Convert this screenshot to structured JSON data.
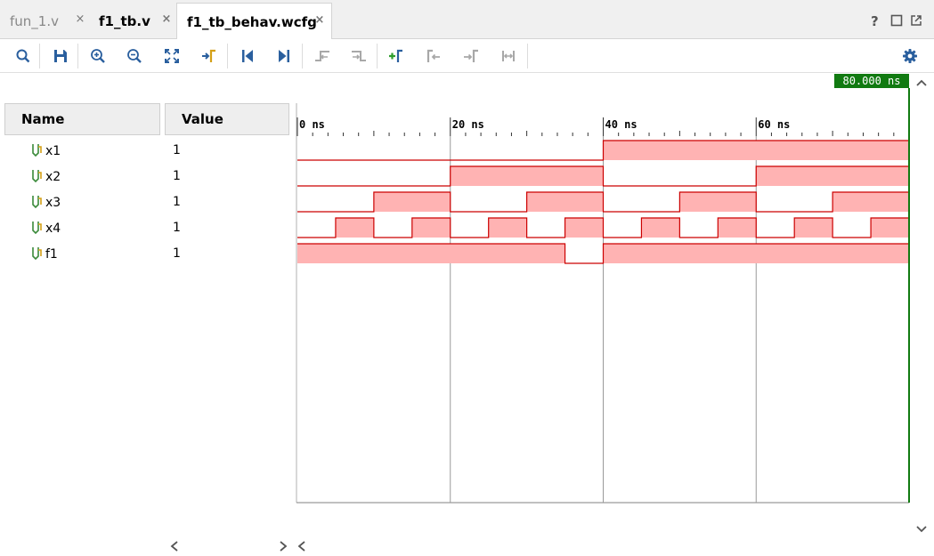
{
  "tabs": [
    {
      "label": "fun_1.v",
      "active": false
    },
    {
      "label": "f1_tb.v",
      "active": false
    },
    {
      "label": "f1_tb_behav.wcfg",
      "active": true
    }
  ],
  "tab_close_glyph": "×",
  "window_controls": {
    "help": "?"
  },
  "toolbar_icons": [
    "search-icon",
    "save-icon",
    "zoom-in-icon",
    "zoom-out-icon",
    "zoom-fit-icon",
    "go-to-cursor-icon",
    "go-to-time-zero-icon",
    "go-to-last-time-icon",
    "previous-transition-icon",
    "next-transition-icon",
    "add-marker-icon",
    "previous-marker-icon",
    "next-marker-icon",
    "swap-cursors-icon"
  ],
  "columns": {
    "name": "Name",
    "value": "Value"
  },
  "cursor": {
    "label": "80.000 ns",
    "time": 80
  },
  "timeline": {
    "unit": "ns",
    "ticks": [
      {
        "t": 0,
        "label": "0 ns"
      },
      {
        "t": 20,
        "label": "20 ns"
      },
      {
        "t": 40,
        "label": "40 ns"
      },
      {
        "t": 60,
        "label": "60 ns"
      }
    ],
    "end": 80
  },
  "signals": [
    {
      "name": "x1",
      "value": "1",
      "transitions": [
        [
          0,
          0
        ],
        [
          40,
          1
        ]
      ]
    },
    {
      "name": "x2",
      "value": "1",
      "transitions": [
        [
          0,
          0
        ],
        [
          20,
          1
        ],
        [
          40,
          0
        ],
        [
          60,
          1
        ]
      ]
    },
    {
      "name": "x3",
      "value": "1",
      "transitions": [
        [
          0,
          0
        ],
        [
          10,
          1
        ],
        [
          20,
          0
        ],
        [
          30,
          1
        ],
        [
          40,
          0
        ],
        [
          50,
          1
        ],
        [
          60,
          0
        ],
        [
          70,
          1
        ]
      ]
    },
    {
      "name": "x4",
      "value": "1",
      "transitions": [
        [
          0,
          0
        ],
        [
          5,
          1
        ],
        [
          10,
          0
        ],
        [
          15,
          1
        ],
        [
          20,
          0
        ],
        [
          25,
          1
        ],
        [
          30,
          0
        ],
        [
          35,
          1
        ],
        [
          40,
          0
        ],
        [
          45,
          1
        ],
        [
          50,
          0
        ],
        [
          55,
          1
        ],
        [
          60,
          0
        ],
        [
          65,
          1
        ],
        [
          70,
          0
        ],
        [
          75,
          1
        ]
      ]
    },
    {
      "name": "f1",
      "value": "1",
      "transitions": [
        [
          0,
          1
        ],
        [
          35,
          0
        ],
        [
          40,
          1
        ]
      ]
    }
  ],
  "colors": {
    "high_fill": "#ffb3b3",
    "wave_line": "#cc0000",
    "cursor": "#117a11",
    "grid": "#9a9a9a"
  }
}
